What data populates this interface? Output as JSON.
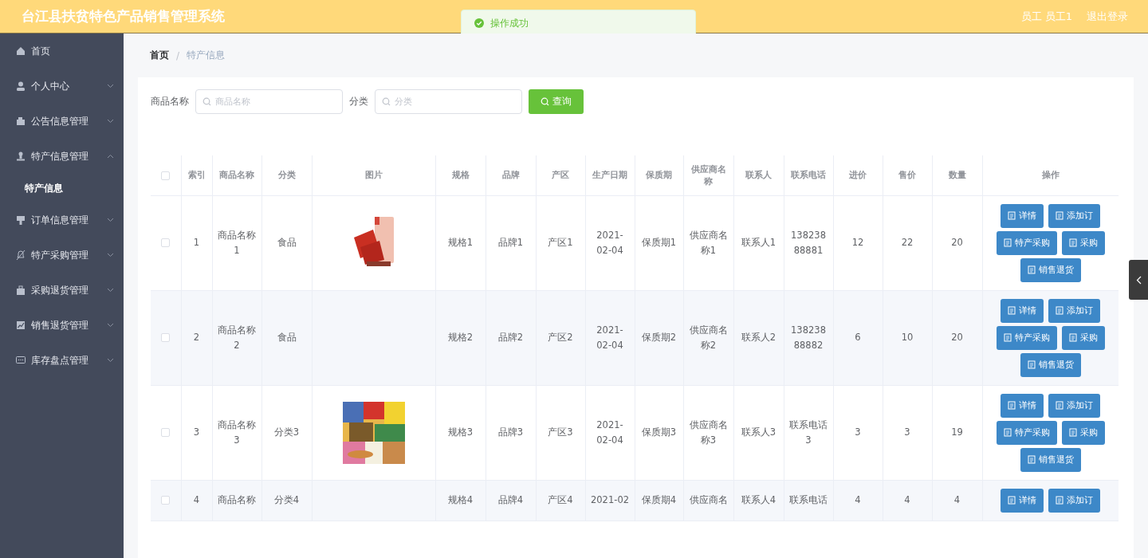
{
  "header": {
    "title": "台江县扶贫特色产品销售管理系统",
    "user": "员工 员工1",
    "logout": "退出登录"
  },
  "toast": {
    "message": "操作成功"
  },
  "sidebar": {
    "items": [
      {
        "label": "首页"
      },
      {
        "label": "个人中心",
        "expanded": false
      },
      {
        "label": "公告信息管理",
        "expanded": false
      },
      {
        "label": "特产信息管理",
        "expanded": true,
        "children": [
          {
            "label": "特产信息",
            "selected": true
          }
        ]
      },
      {
        "label": "订单信息管理",
        "expanded": false
      },
      {
        "label": "特产采购管理",
        "expanded": false
      },
      {
        "label": "采购退货管理",
        "expanded": false
      },
      {
        "label": "销售退货管理",
        "expanded": false
      },
      {
        "label": "库存盘点管理",
        "expanded": false
      }
    ]
  },
  "breadcrumb": {
    "separator": "/",
    "items": [
      "首页",
      "特产信息"
    ]
  },
  "search": {
    "fields": [
      {
        "label": "商品名称",
        "placeholder": "商品名称"
      },
      {
        "label": "分类",
        "placeholder": "分类"
      }
    ],
    "button": "查询"
  },
  "table": {
    "header_checked": false,
    "columns": [
      {
        "kind": "text",
        "label": "索引"
      },
      {
        "kind": "text",
        "label": "商品名称"
      },
      {
        "kind": "text",
        "label": "分类"
      },
      {
        "label": "图片"
      },
      {
        "kind": "text",
        "label": "规格"
      },
      {
        "kind": "text",
        "label": "品牌"
      },
      {
        "kind": "text",
        "label": "产区"
      },
      {
        "kind": "text",
        "label": "生产日期"
      },
      {
        "kind": "text",
        "label": "保质期"
      },
      {
        "kind": "text",
        "label": "供应商名称"
      },
      {
        "kind": "text",
        "label": "联系人"
      },
      {
        "kind": "text",
        "label": "联系电话"
      },
      {
        "kind": "text",
        "label": "进价"
      },
      {
        "kind": "text",
        "label": "售价"
      },
      {
        "kind": "text",
        "label": "数量"
      },
      {
        "kind": "actions",
        "label": "操作"
      }
    ],
    "rows": [
      {
        "checked": false,
        "image": {
          "kind": "picture"
        },
        "cells": [
          "1",
          "商品名称1",
          "食品",
          "",
          "规格1",
          "品牌1",
          "产区1",
          "2021-02-04",
          "保质期1",
          "供应商名称1",
          "联系人1",
          "13823888881",
          "12",
          "22",
          "20"
        ],
        "actions": [
          [
            "详情",
            "添加订"
          ],
          [
            "特产采购",
            "采购"
          ],
          [
            "销售退货"
          ]
        ]
      },
      {
        "checked": false,
        "cells": [
          "2",
          "商品名称2",
          "食品",
          "",
          "规格2",
          "品牌2",
          "产区2",
          "2021-02-04",
          "保质期2",
          "供应商名称2",
          "联系人2",
          "13823888882",
          "6",
          "10",
          "20"
        ],
        "actions": [
          [
            "详情",
            "添加订"
          ],
          [
            "特产采购",
            "采购"
          ],
          [
            "销售退货"
          ]
        ]
      },
      {
        "checked": false,
        "image": {
          "kind": "picture"
        },
        "cells": [
          "3",
          "商品名称3",
          "分类3",
          "",
          "规格3",
          "品牌3",
          "产区3",
          "2021-02-04",
          "保质期3",
          "供应商名称3",
          "联系人3",
          "联系电话3",
          "3",
          "3",
          "19"
        ],
        "actions": [
          [
            "详情",
            "添加订"
          ],
          [
            "特产采购",
            "采购"
          ],
          [
            "销售退货"
          ]
        ]
      },
      {
        "checked": false,
        "cells": [
          "4",
          "商品名称",
          "分类4",
          "",
          "规格4",
          "品牌4",
          "产区4",
          "2021-02",
          "保质期4",
          "供应商名",
          "联系人4",
          "联系电话",
          "4",
          "4",
          "4"
        ],
        "actions": [
          [
            "详情",
            "添加订"
          ]
        ]
      }
    ]
  }
}
